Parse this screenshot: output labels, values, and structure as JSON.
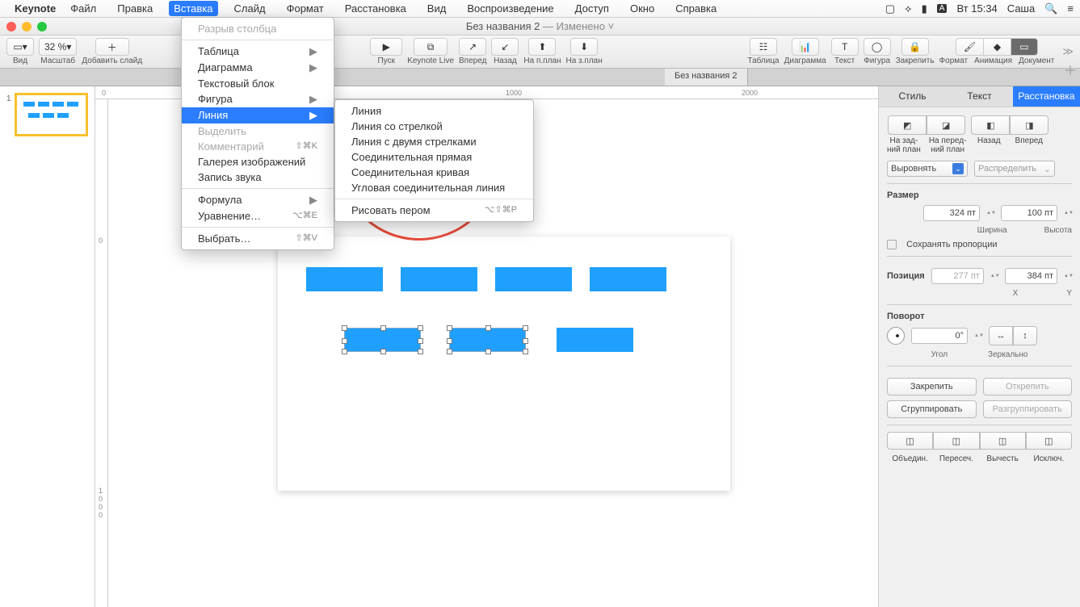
{
  "menubar": {
    "app": "Keynote",
    "items": [
      "Файл",
      "Правка",
      "Вставка",
      "Слайд",
      "Формат",
      "Расстановка",
      "Вид",
      "Воспроизведение",
      "Доступ",
      "Окно",
      "Справка"
    ],
    "time": "Вт 15:34",
    "user": "Саша"
  },
  "window": {
    "title": "Без названия 2",
    "modified": "— Изменено"
  },
  "toolbar": {
    "view": "Вид",
    "zoom": "32 %",
    "zoom_label": "Масштаб",
    "addslide": "Добавить слайд",
    "play": "Пуск",
    "live": "Keynote Live",
    "forward": "Вперед",
    "back": "Назад",
    "tofront": "На п.план",
    "toback": "На з.план",
    "table": "Таблица",
    "chart": "Диаграмма",
    "text": "Текст",
    "shape": "Фигура",
    "lock": "Закрепить",
    "format": "Формат",
    "animate": "Анимация",
    "document": "Документ"
  },
  "doctab": "Без названия 2",
  "ruler": {
    "m0": "0",
    "m1000": "1000",
    "m2000": "2000",
    "v0": "0",
    "v1000a": "1",
    "v1000b": "0",
    "v1000c": "0",
    "v1000d": "0"
  },
  "thumb_num": "1",
  "dropdown1": {
    "break": "Разрыв столбца",
    "table": "Таблица",
    "chart": "Диаграмма",
    "textbox": "Текстовый блок",
    "shape": "Фигура",
    "line": "Линия",
    "highlight": "Выделить",
    "comment": "Комментарий",
    "comment_sc": "⇧⌘K",
    "gallery": "Галерея изображений",
    "audio": "Запись звука",
    "formula": "Формула",
    "equation": "Уравнение…",
    "equation_sc": "⌥⌘E",
    "choose": "Выбрать…",
    "choose_sc": "⇧⌘V"
  },
  "dropdown2": {
    "line": "Линия",
    "arrow": "Линия со стрелкой",
    "double": "Линия с двумя стрелками",
    "conn_straight": "Соединительная прямая",
    "conn_curve": "Соединительная кривая",
    "conn_angle": "Угловая соединительная линия",
    "pen": "Рисовать пером",
    "pen_sc": "⌥⇧⌘P"
  },
  "sidepanel": {
    "tab_style": "Стиль",
    "tab_text": "Текст",
    "tab_arrange": "Расстановка",
    "toback": "На зад-\nний план",
    "tofront": "На перед-\nний план",
    "back": "Назад",
    "forward": "Вперед",
    "align": "Выровнять",
    "distribute": "Распределить",
    "size_label": "Размер",
    "width": "Ширина",
    "height": "Высота",
    "w_val": "324 пт",
    "h_val": "100 пт",
    "constrain": "Сохранять пропорции",
    "pos_label": "Позиция",
    "x_label": "X",
    "y_label": "Y",
    "x_val": "277 пт",
    "y_val": "384 пт",
    "rotate_label": "Поворот",
    "angle": "0°",
    "angle_label": "Угол",
    "mirror": "Зеркально",
    "lock": "Закрепить",
    "unlock": "Открепить",
    "group": "Сгруппировать",
    "ungroup": "Разгруппировать",
    "union": "Объедин.",
    "intersect": "Пересеч.",
    "subtract": "Вычесть",
    "exclude": "Исключ."
  }
}
